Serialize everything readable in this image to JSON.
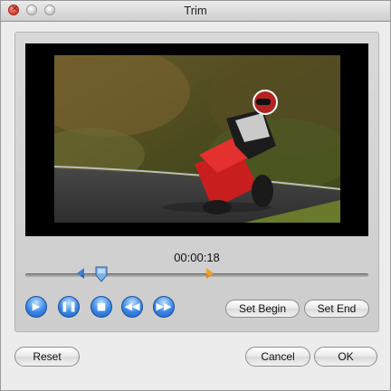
{
  "window": {
    "title": "Trim"
  },
  "player": {
    "timecode": "00:00:18",
    "playhead_position_fraction": 0.22,
    "begin_marker_fraction": 0.18,
    "end_marker_fraction": 0.53
  },
  "controls": {
    "play_icon": "play-icon",
    "pause_icon": "pause-icon",
    "stop_icon": "stop-icon",
    "rewind_icon": "rewind-icon",
    "fast_forward_icon": "fast-forward-icon"
  },
  "buttons": {
    "set_begin": "Set Begin",
    "set_end": "Set End",
    "reset": "Reset",
    "cancel": "Cancel",
    "ok": "OK"
  },
  "colors": {
    "accent_blue": "#3a87e6",
    "begin_marker": "#3f7fd6",
    "end_marker": "#f0a028"
  }
}
